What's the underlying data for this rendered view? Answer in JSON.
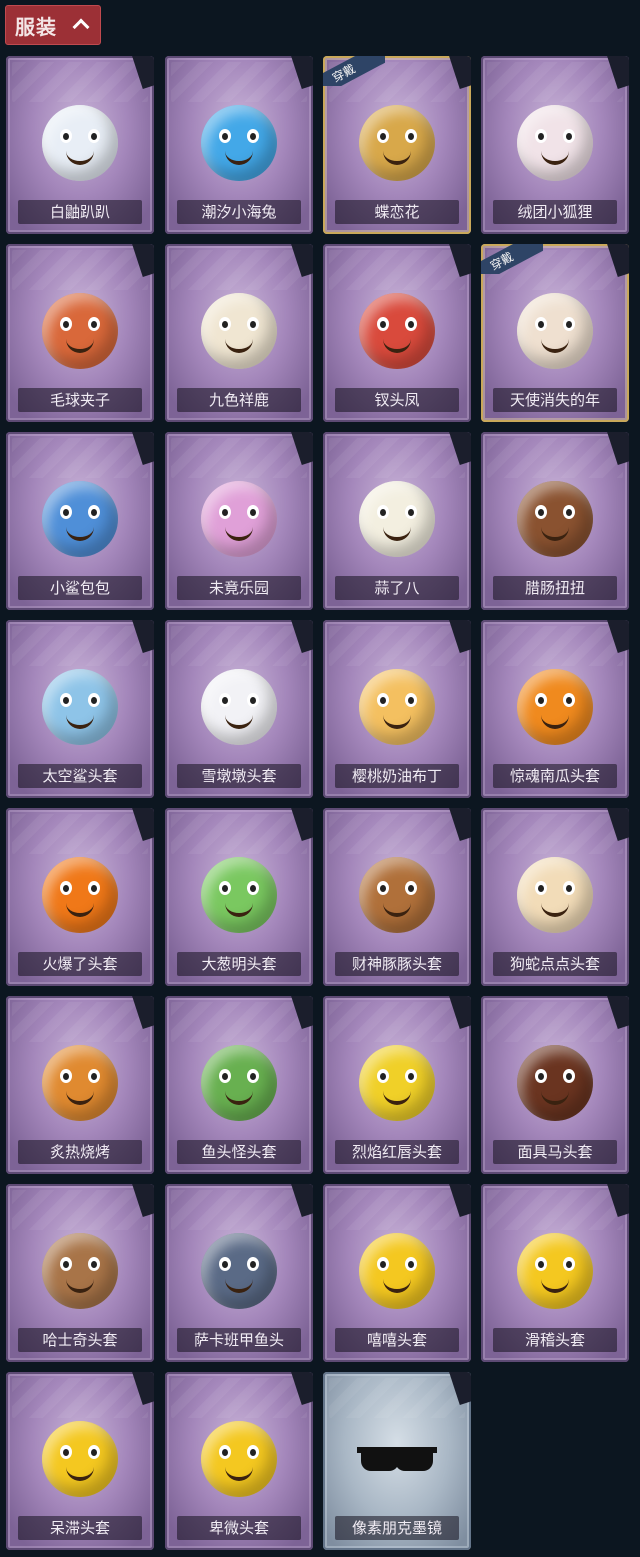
{
  "header": {
    "tab_label": "服装"
  },
  "badge_label": "穿戴",
  "items": [
    {
      "name": "白鼬趴趴",
      "color": "#e8eef6",
      "worn": false
    },
    {
      "name": "潮汐小海兔",
      "color": "#43a8e8",
      "worn": false
    },
    {
      "name": "蝶恋花",
      "color": "#d8a84a",
      "worn": true
    },
    {
      "name": "绒团小狐狸",
      "color": "#f1e3e8",
      "worn": false
    },
    {
      "name": "毛球夹子",
      "color": "#d9683a",
      "worn": false
    },
    {
      "name": "九色祥鹿",
      "color": "#f0e6d2",
      "worn": false
    },
    {
      "name": "钗头凤",
      "color": "#d94a3c",
      "worn": false
    },
    {
      "name": "天使消失的年",
      "color": "#efe0d0",
      "worn": true
    },
    {
      "name": "小鲨包包",
      "color": "#4f8fd8",
      "worn": false
    },
    {
      "name": "未竟乐园",
      "color": "#e0a0d8",
      "worn": false
    },
    {
      "name": "蒜了八",
      "color": "#f3efe0",
      "worn": false
    },
    {
      "name": "腊肠扭扭",
      "color": "#8a5230",
      "worn": false
    },
    {
      "name": "太空鲨头套",
      "color": "#8ec4e8",
      "worn": false
    },
    {
      "name": "雪墩墩头套",
      "color": "#f2f2f6",
      "worn": false
    },
    {
      "name": "樱桃奶油布丁",
      "color": "#f4c060",
      "worn": false
    },
    {
      "name": "惊魂南瓜头套",
      "color": "#f08a1e",
      "worn": false
    },
    {
      "name": "火爆了头套",
      "color": "#f07818",
      "worn": false
    },
    {
      "name": "大葱明头套",
      "color": "#7ac860",
      "worn": false
    },
    {
      "name": "财神豚豚头套",
      "color": "#b0703a",
      "worn": false
    },
    {
      "name": "狗蛇点点头套",
      "color": "#f2dcb8",
      "worn": false
    },
    {
      "name": "炙热烧烤",
      "color": "#e08a30",
      "worn": false
    },
    {
      "name": "鱼头怪头套",
      "color": "#68b050",
      "worn": false
    },
    {
      "name": "烈焰红唇头套",
      "color": "#f0d028",
      "worn": false
    },
    {
      "name": "面具马头套",
      "color": "#6a3420",
      "worn": false
    },
    {
      "name": "哈士奇头套",
      "color": "#a87448",
      "worn": false
    },
    {
      "name": "萨卡班甲鱼头",
      "color": "#5a6a86",
      "worn": false
    },
    {
      "name": "嘻嘻头套",
      "color": "#f4c820",
      "worn": false
    },
    {
      "name": "滑稽头套",
      "color": "#f4c820",
      "worn": false
    },
    {
      "name": "呆滞头套",
      "color": "#f4c820",
      "worn": false
    },
    {
      "name": "卑微头套",
      "color": "#f4c820",
      "worn": false
    },
    {
      "name": "像素朋克墨镜",
      "color": "#111111",
      "worn": false
    }
  ]
}
